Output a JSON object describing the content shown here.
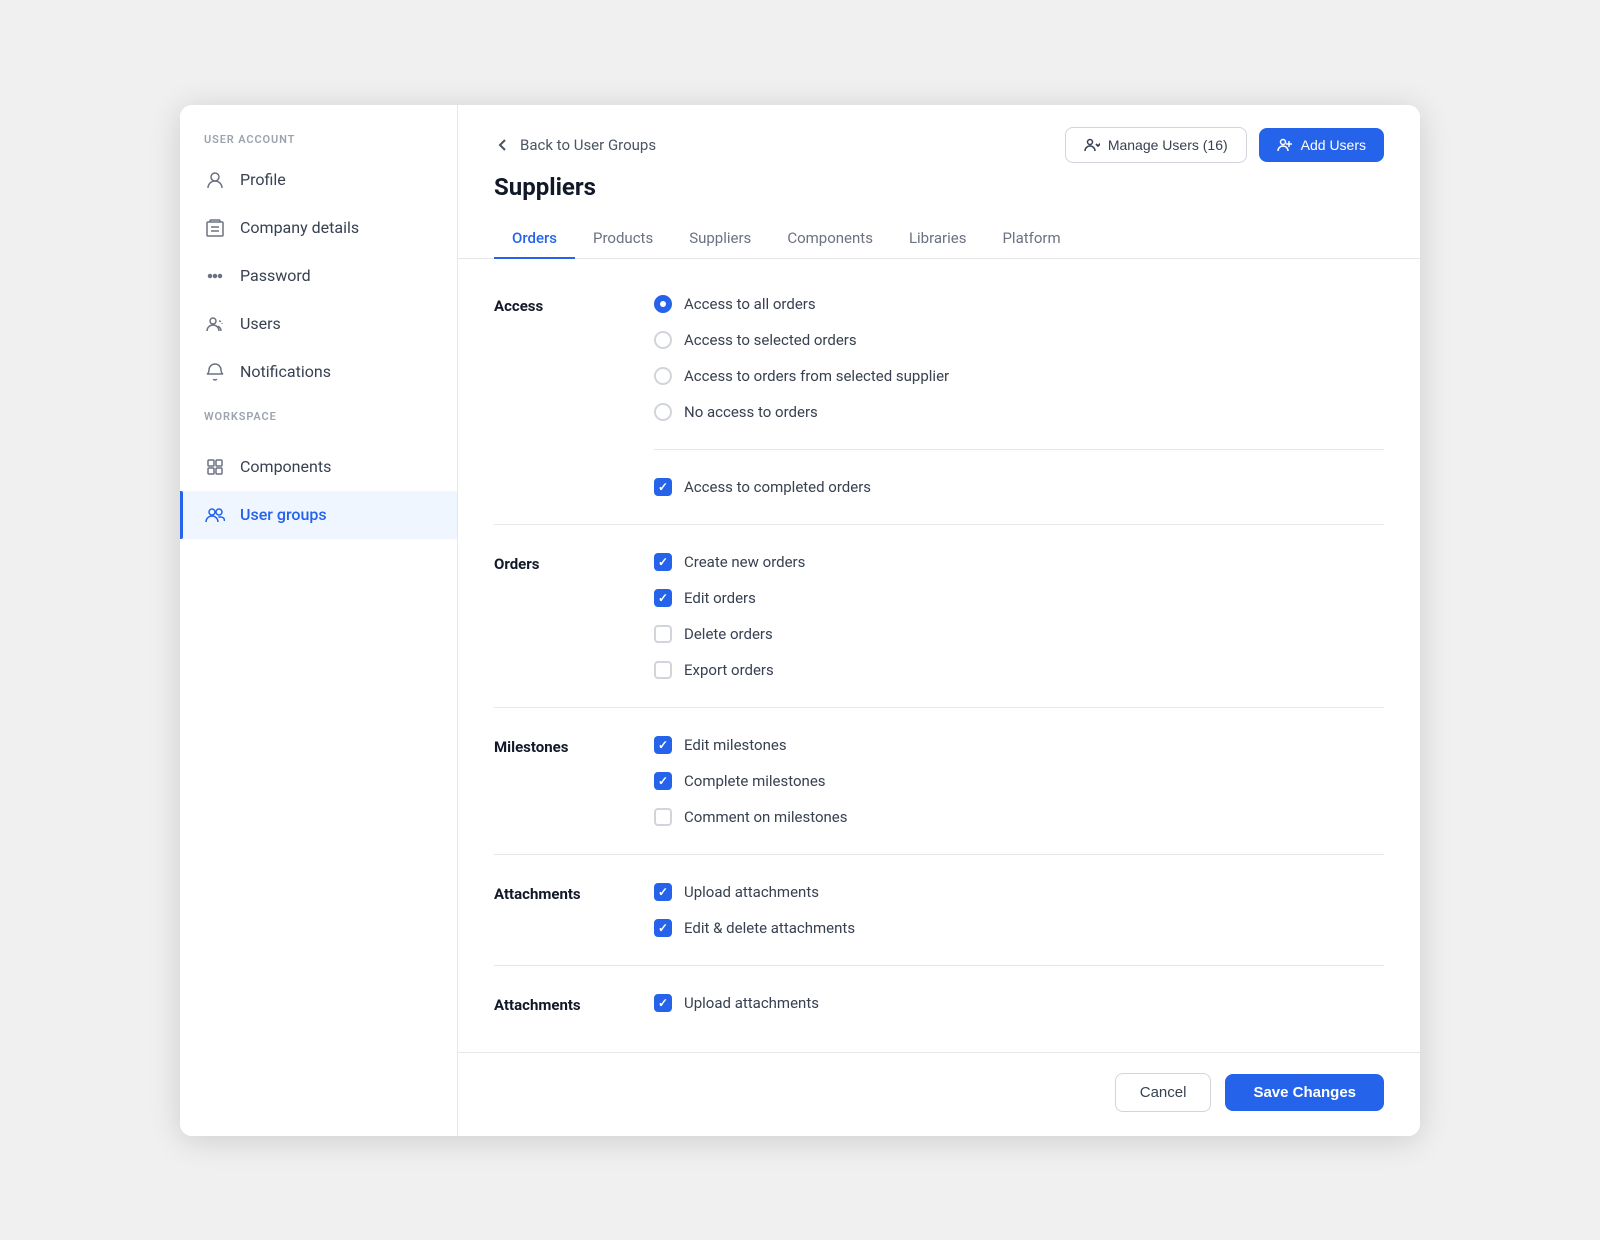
{
  "sidebar": {
    "user_account_label": "USER ACCOUNT",
    "workspace_label": "WORKSPACE",
    "items": [
      {
        "id": "profile",
        "label": "Profile",
        "icon": "profile-icon",
        "active": false
      },
      {
        "id": "company-details",
        "label": "Company details",
        "icon": "company-icon",
        "active": false
      },
      {
        "id": "password",
        "label": "Password",
        "icon": "password-icon",
        "active": false
      },
      {
        "id": "users",
        "label": "Users",
        "icon": "users-icon",
        "active": false
      },
      {
        "id": "notifications",
        "label": "Notifications",
        "icon": "notifications-icon",
        "active": false
      },
      {
        "id": "components",
        "label": "Components",
        "icon": "components-icon",
        "active": false
      },
      {
        "id": "user-groups",
        "label": "User groups",
        "icon": "user-groups-icon",
        "active": true
      }
    ]
  },
  "topbar": {
    "back_label": "Back to User Groups",
    "manage_users_label": "Manage Users (16)",
    "add_users_label": "Add Users"
  },
  "page": {
    "title": "Suppliers"
  },
  "tabs": [
    {
      "id": "orders",
      "label": "Orders",
      "active": true
    },
    {
      "id": "products",
      "label": "Products",
      "active": false
    },
    {
      "id": "suppliers",
      "label": "Suppliers",
      "active": false
    },
    {
      "id": "components",
      "label": "Components",
      "active": false
    },
    {
      "id": "libraries",
      "label": "Libraries",
      "active": false
    },
    {
      "id": "platform",
      "label": "Platform",
      "active": false
    }
  ],
  "sections": [
    {
      "id": "access",
      "label": "Access",
      "type": "mixed",
      "radio_options": [
        {
          "id": "all-orders",
          "label": "Access to all orders",
          "checked": true
        },
        {
          "id": "selected-orders",
          "label": "Access to selected orders",
          "checked": false
        },
        {
          "id": "orders-from-supplier",
          "label": "Access to orders from selected supplier",
          "checked": false
        },
        {
          "id": "no-access",
          "label": "No access to orders",
          "checked": false
        }
      ],
      "checkbox_options": [
        {
          "id": "completed-orders",
          "label": "Access to completed orders",
          "checked": true
        }
      ]
    },
    {
      "id": "orders",
      "label": "Orders",
      "type": "checkbox",
      "options": [
        {
          "id": "create-orders",
          "label": "Create new orders",
          "checked": true
        },
        {
          "id": "edit-orders",
          "label": "Edit orders",
          "checked": true
        },
        {
          "id": "delete-orders",
          "label": "Delete orders",
          "checked": false
        },
        {
          "id": "export-orders",
          "label": "Export orders",
          "checked": false
        }
      ]
    },
    {
      "id": "milestones",
      "label": "Milestones",
      "type": "checkbox",
      "options": [
        {
          "id": "edit-milestones",
          "label": "Edit milestones",
          "checked": true
        },
        {
          "id": "complete-milestones",
          "label": "Complete milestones",
          "checked": true
        },
        {
          "id": "comment-milestones",
          "label": "Comment on milestones",
          "checked": false
        }
      ]
    },
    {
      "id": "attachments",
      "label": "Attachments",
      "type": "checkbox",
      "options": [
        {
          "id": "upload-attachments",
          "label": "Upload attachments",
          "checked": true
        },
        {
          "id": "edit-delete-attachments",
          "label": "Edit & delete attachments",
          "checked": true
        }
      ]
    },
    {
      "id": "attachments2",
      "label": "Attachments",
      "type": "checkbox",
      "options": [
        {
          "id": "upload-attachments2",
          "label": "Upload attachments",
          "checked": true
        }
      ]
    }
  ],
  "footer": {
    "cancel_label": "Cancel",
    "save_label": "Save Changes"
  }
}
